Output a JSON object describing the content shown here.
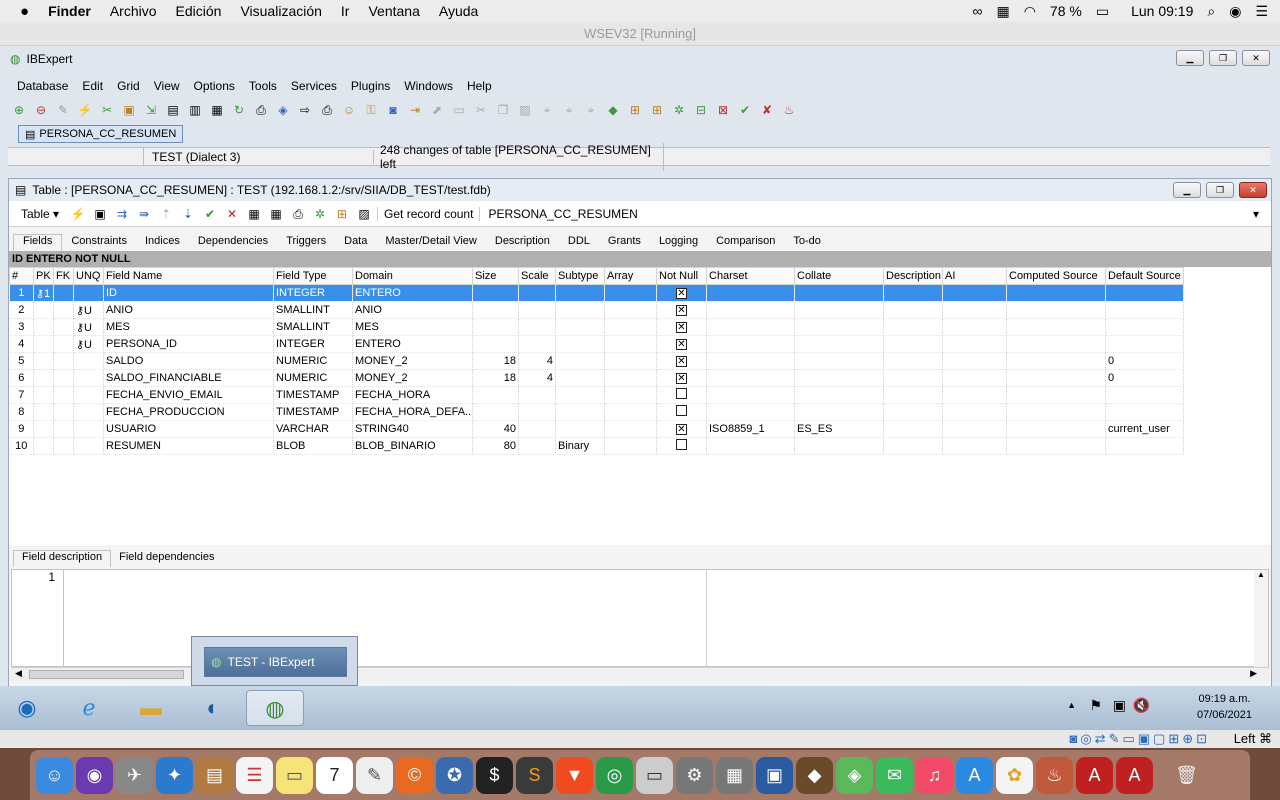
{
  "mac_menu": {
    "apple": "",
    "app": "Finder",
    "items": [
      "Archivo",
      "Edición",
      "Visualización",
      "Ir",
      "Ventana",
      "Ayuda"
    ],
    "battery": "78 %",
    "clock": "Lun 09:19"
  },
  "vm_title": "WSEV32 [Running]",
  "ibexpert": {
    "title": "IBExpert",
    "menu": [
      "Database",
      "Edit",
      "Grid",
      "View",
      "Options",
      "Tools",
      "Services",
      "Plugins",
      "Windows",
      "Help"
    ],
    "doc_tab": "PERSONA_CC_RESUMEN",
    "status_db": "TEST (Dialect 3)",
    "status_msg": "248 changes of table [PERSONA_CC_RESUMEN] left"
  },
  "child": {
    "title": "Table : [PERSONA_CC_RESUMEN] : TEST (192.168.1.2:/srv/SIIA/DB_TEST/test.fdb)",
    "table_btn": "Table",
    "record_count_btn": "Get record count",
    "table_name": "PERSONA_CC_RESUMEN",
    "tabs": [
      "Fields",
      "Constraints",
      "Indices",
      "Dependencies",
      "Triggers",
      "Data",
      "Master/Detail View",
      "Description",
      "DDL",
      "Grants",
      "Logging",
      "Comparison",
      "To-do"
    ],
    "hint": "ID ENTERO NOT NULL",
    "columns": [
      "#",
      "PK",
      "FK",
      "UNQ",
      "Field Name",
      "Field Type",
      "Domain",
      "Size",
      "Scale",
      "Subtype",
      "Array",
      "Not Null",
      "Charset",
      "Collate",
      "Description",
      "AI",
      "Computed Source",
      "Default Source"
    ],
    "rows": [
      {
        "n": "1",
        "pk": "⚷1",
        "unq": "",
        "name": "ID",
        "type": "INTEGER",
        "domain": "ENTERO",
        "size": "",
        "scale": "",
        "subtype": "",
        "nn": true,
        "charset": "",
        "collate": "",
        "def": ""
      },
      {
        "n": "2",
        "pk": "",
        "unq": "⚷U",
        "name": "ANIO",
        "type": "SMALLINT",
        "domain": "ANIO",
        "size": "",
        "scale": "",
        "subtype": "",
        "nn": true,
        "charset": "",
        "collate": "",
        "def": ""
      },
      {
        "n": "3",
        "pk": "",
        "unq": "⚷U",
        "name": "MES",
        "type": "SMALLINT",
        "domain": "MES",
        "size": "",
        "scale": "",
        "subtype": "",
        "nn": true,
        "charset": "",
        "collate": "",
        "def": ""
      },
      {
        "n": "4",
        "pk": "",
        "unq": "⚷U",
        "name": "PERSONA_ID",
        "type": "INTEGER",
        "domain": "ENTERO",
        "size": "",
        "scale": "",
        "subtype": "",
        "nn": true,
        "charset": "",
        "collate": "",
        "def": ""
      },
      {
        "n": "5",
        "pk": "",
        "unq": "",
        "name": "SALDO",
        "type": "NUMERIC",
        "domain": "MONEY_2",
        "size": "18",
        "scale": "4",
        "subtype": "",
        "nn": true,
        "charset": "",
        "collate": "",
        "def": "0"
      },
      {
        "n": "6",
        "pk": "",
        "unq": "",
        "name": "SALDO_FINANCIABLE",
        "type": "NUMERIC",
        "domain": "MONEY_2",
        "size": "18",
        "scale": "4",
        "subtype": "",
        "nn": true,
        "charset": "",
        "collate": "",
        "def": "0"
      },
      {
        "n": "7",
        "pk": "",
        "unq": "",
        "name": "FECHA_ENVIO_EMAIL",
        "type": "TIMESTAMP",
        "domain": "FECHA_HORA",
        "size": "",
        "scale": "",
        "subtype": "",
        "nn": false,
        "charset": "",
        "collate": "",
        "def": ""
      },
      {
        "n": "8",
        "pk": "",
        "unq": "",
        "name": "FECHA_PRODUCCION",
        "type": "TIMESTAMP",
        "domain": "FECHA_HORA_DEFA...",
        "size": "",
        "scale": "",
        "subtype": "",
        "nn": false,
        "charset": "",
        "collate": "",
        "def": ""
      },
      {
        "n": "9",
        "pk": "",
        "unq": "",
        "name": "USUARIO",
        "type": "VARCHAR",
        "domain": "STRING40",
        "size": "40",
        "scale": "",
        "subtype": "",
        "nn": true,
        "charset": "ISO8859_1",
        "collate": "ES_ES",
        "def": "current_user"
      },
      {
        "n": "10",
        "pk": "",
        "unq": "",
        "name": "RESUMEN",
        "type": "BLOB",
        "domain": "BLOB_BINARIO",
        "size": "80",
        "scale": "",
        "subtype": "Binary",
        "nn": false,
        "charset": "",
        "collate": "",
        "def": ""
      }
    ],
    "lower_tabs": [
      "Field description",
      "Field dependencies"
    ],
    "line_no": "1"
  },
  "taskbar": {
    "popup": "TEST - IBExpert",
    "time": "09:19 a.m.",
    "date": "07/06/2021"
  },
  "vm_status": "Left ⌘"
}
